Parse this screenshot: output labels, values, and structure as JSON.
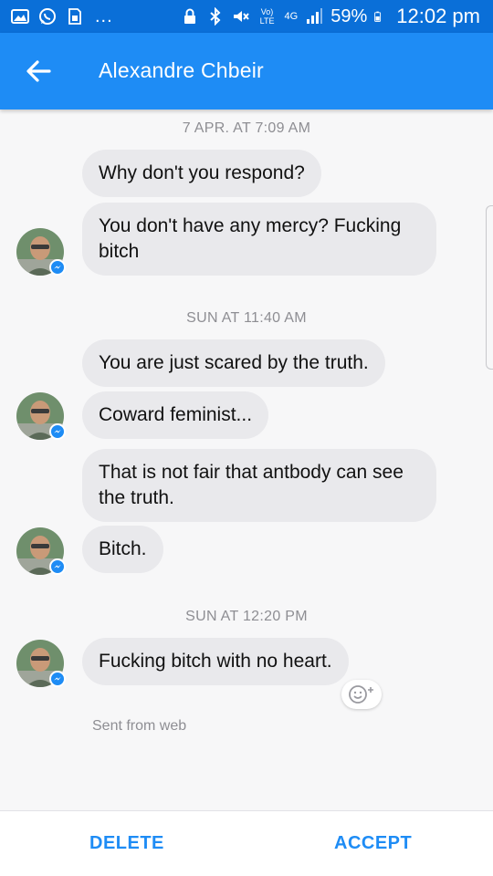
{
  "status_bar": {
    "icons": [
      "gallery-icon",
      "whatsapp-icon",
      "sim-icon",
      "lock-icon",
      "bluetooth-icon",
      "mute-icon",
      "volte-icon",
      "4g-icon",
      "signal-icon",
      "battery-icon"
    ],
    "more": "...",
    "volte": "Vo) LTE",
    "network": "4G",
    "battery": "59%",
    "time": "12:02 pm"
  },
  "header": {
    "title": "Alexandre Chbeir",
    "back_icon": "arrow-left-icon"
  },
  "colors": {
    "accent": "#1e8cf5",
    "status_bar": "#0a6fd8",
    "bubble": "#e9e9ec",
    "muted": "#8e8e93"
  },
  "conversation": {
    "timestamps": [
      "7 APR. AT 7:09 AM",
      "SUN AT 11:40 AM",
      "SUN AT 12:20 PM"
    ],
    "messages": [
      "Why don't you respond?",
      "You don't have any mercy? Fucking bitch",
      "You are just scared by the truth.",
      "Coward feminist...",
      "That is not fair that antbody can see the truth.",
      "Bitch.",
      "Fucking bitch with no heart."
    ],
    "sent_from": "Sent from web",
    "react_icon": "smiley-plus-icon"
  },
  "actions": {
    "delete": "DELETE",
    "accept": "ACCEPT"
  }
}
